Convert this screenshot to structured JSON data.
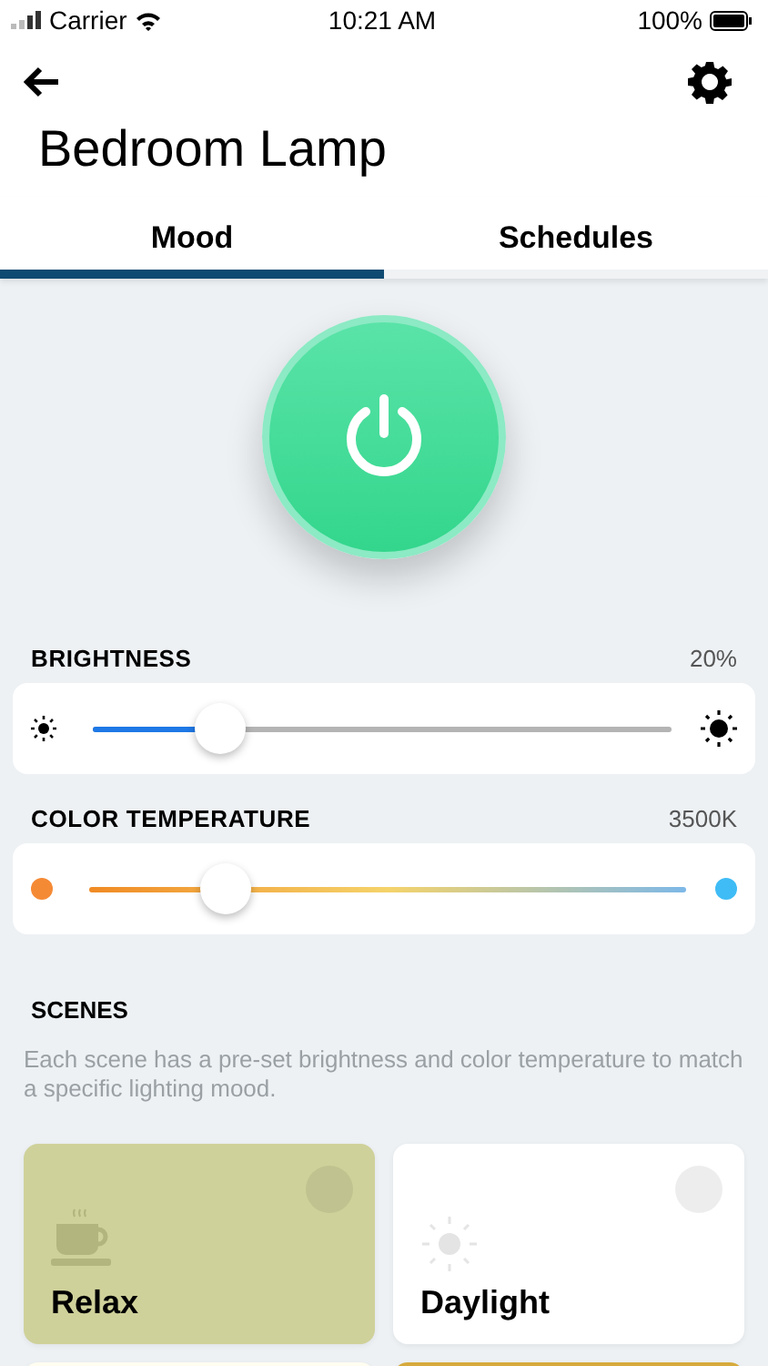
{
  "status_bar": {
    "carrier": "Carrier",
    "time": "10:21 AM",
    "battery": "100%"
  },
  "title": "Bedroom Lamp",
  "tabs": [
    {
      "label": "Mood",
      "selected": true
    },
    {
      "label": "Schedules",
      "selected": false
    }
  ],
  "power": {
    "on": true
  },
  "brightness": {
    "label": "BRIGHTNESS",
    "reading": "20%",
    "level": 0.22
  },
  "color_temperature": {
    "label": "COLOR TEMPERATURE",
    "reading": "3500K",
    "level": 0.23
  },
  "scenes": {
    "heading": "SCENES",
    "description": "Each scene has a pre-set brightness and color temperature to match a specific lighting mood.",
    "items": [
      {
        "label": "Relax",
        "kind": "cup",
        "color": "#cfd19a"
      },
      {
        "label": "Daylight",
        "kind": "sun",
        "color": "#ffffff"
      },
      {
        "kind": "blank",
        "color": "#fffdf0"
      },
      {
        "kind": "blank",
        "color": "#d6aa3c"
      }
    ]
  }
}
